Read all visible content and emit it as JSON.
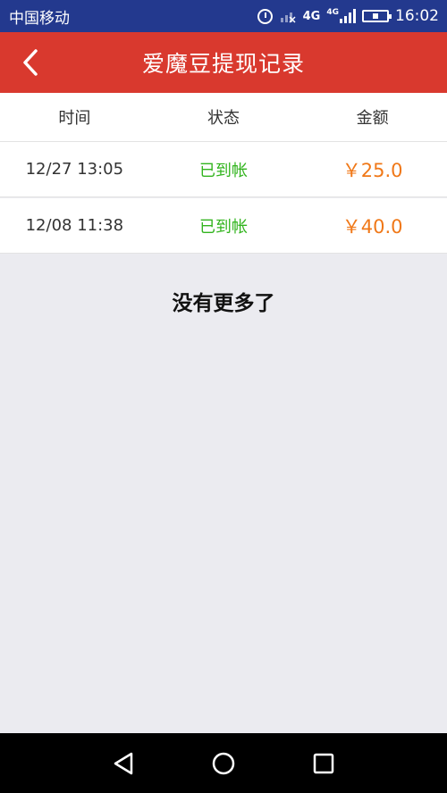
{
  "status_bar": {
    "carrier": "中国移动",
    "network_labels": [
      "4G",
      "4G"
    ],
    "time": "16:02",
    "icons": [
      "alarm-icon",
      "signal-no-sim-icon",
      "network-4g-icon",
      "signal-4g-icon",
      "battery-icon"
    ]
  },
  "header": {
    "title": "爱魔豆提现记录",
    "back_icon": "chevron-left-icon",
    "background_color": "#d9392e"
  },
  "table": {
    "columns": [
      "时间",
      "状态",
      "金额"
    ],
    "rows": [
      {
        "time": "12/27 13:05",
        "status": "已到帐",
        "amount": "￥25.0"
      },
      {
        "time": "12/08 11:38",
        "status": "已到帐",
        "amount": "￥40.0"
      }
    ]
  },
  "footer_message": "没有更多了",
  "nav_bar": {
    "buttons": [
      "back-triangle-icon",
      "home-circle-icon",
      "recents-square-icon"
    ]
  },
  "colors": {
    "status_bar": "#23398e",
    "status_green": "#32b41e",
    "amount_orange": "#f07818",
    "page_background": "#ebebf0"
  }
}
